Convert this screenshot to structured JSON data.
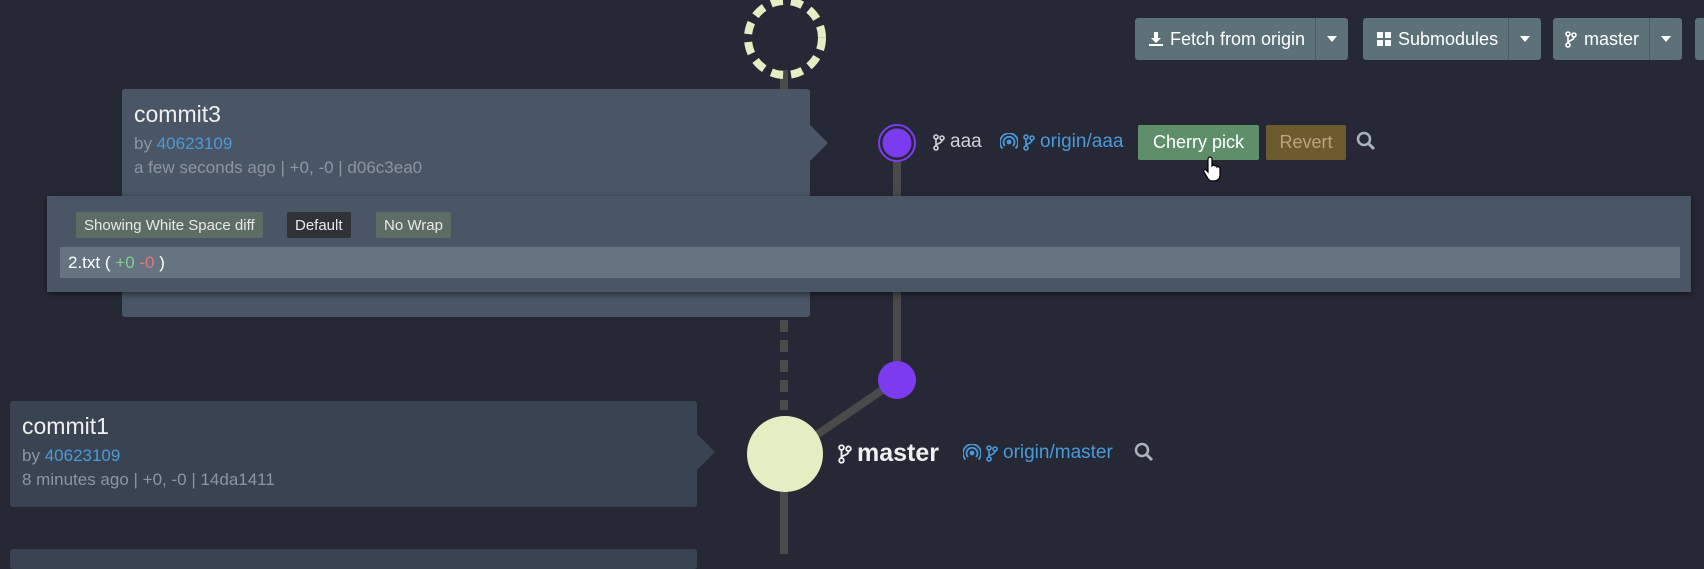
{
  "toolbar": {
    "fetch_label": "Fetch from origin",
    "submodules_label": "Submodules",
    "branch_label": "master"
  },
  "commits": [
    {
      "title": "commit3",
      "by_prefix": "by",
      "author": "40623109",
      "meta": "a few seconds ago | +0, -0 | d06c3ea0",
      "branch": "aaa",
      "remote": "origin/aaa",
      "cherry_pick_label": "Cherry pick",
      "revert_label": "Revert"
    },
    {
      "title": "commit1",
      "by_prefix": "by",
      "author": "40623109",
      "meta": "8 minutes ago | +0, -0 | 14da1411",
      "branch": "master",
      "remote": "origin/master"
    }
  ],
  "diff": {
    "whitespace_label": "Showing White Space diff",
    "default_label": "Default",
    "wrap_label": "No Wrap",
    "file": {
      "name": "2.txt",
      "open": "(",
      "added": "+0",
      "removed": "-0",
      "close": ")"
    }
  },
  "colors": {
    "background": "#262836",
    "node_purple": "#7b3cf0",
    "node_cream": "#e5edc3",
    "cherry_pick": "#5e8f6a",
    "revert": "#6e5a2f",
    "link": "#4a9ad8"
  },
  "icons": [
    "download-icon",
    "grid-icon",
    "branch-icon",
    "remote-icon",
    "search-icon",
    "hand-cursor-icon"
  ]
}
